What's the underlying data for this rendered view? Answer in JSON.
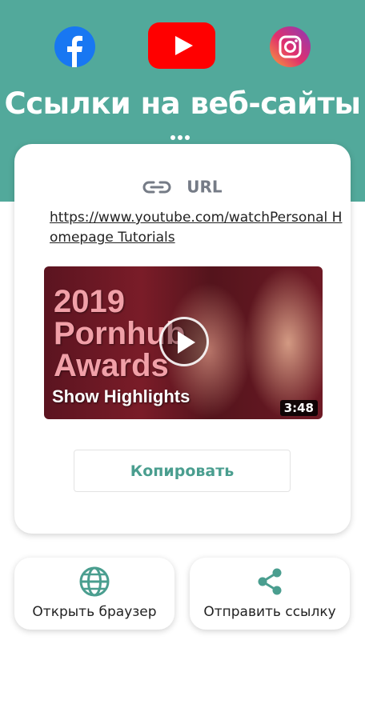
{
  "header": {
    "title": "Ссылки на веб-сайты",
    "social": [
      {
        "name": "facebook",
        "icon": "facebook-icon"
      },
      {
        "name": "youtube",
        "icon": "youtube-icon"
      },
      {
        "name": "instagram",
        "icon": "instagram-icon"
      }
    ]
  },
  "card": {
    "url_label": "URL",
    "url_value": "https://www.youtube.com/watchPersonal Homepage Tutorials",
    "video": {
      "thumb_line1": "2019",
      "thumb_line2": "Pornhub",
      "thumb_line3": "Awards",
      "thumb_line4": "Show Highlights",
      "duration": "3:48"
    },
    "copy_label": "Копировать"
  },
  "actions": {
    "open_browser": "Открыть браузер",
    "share_link": "Отправить ссылку"
  },
  "colors": {
    "header_bg": "#52a99b",
    "accent": "#4a9e8f",
    "youtube_red": "#ff0000",
    "facebook_blue": "#1877f2"
  }
}
